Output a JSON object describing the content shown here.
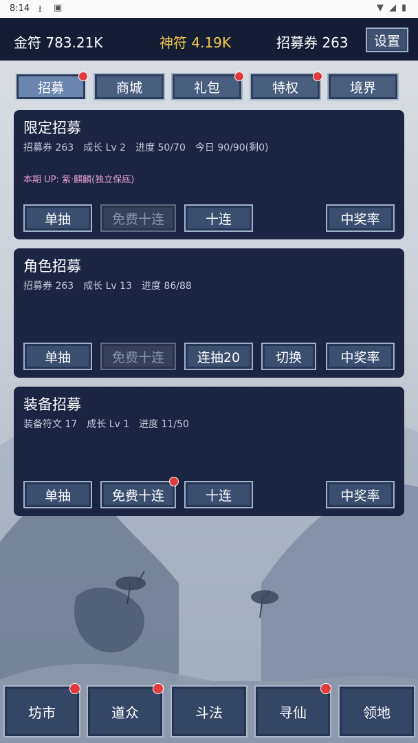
{
  "status_bar": {
    "time": "8:14"
  },
  "currencies": {
    "gold": "金符 783.21K",
    "divine": "神符 4.19K",
    "tickets": "招募券 263"
  },
  "settings_label": "设置",
  "tabs": [
    {
      "label": "招募",
      "active": true,
      "badge": true
    },
    {
      "label": "商城",
      "active": false,
      "badge": false
    },
    {
      "label": "礼包",
      "active": false,
      "badge": true
    },
    {
      "label": "特权",
      "active": false,
      "badge": true
    },
    {
      "label": "境界",
      "active": false,
      "badge": false
    }
  ],
  "cards": [
    {
      "title": "限定招募",
      "info": [
        "招募券 263",
        "成长 Lv 2",
        "进度 50/70",
        "今日 90/90(剩0)"
      ],
      "up": "本期 UP: 紫·麒麟(独立保底)",
      "buttons": [
        {
          "label": "单抽",
          "disabled": false
        },
        {
          "label": "免费十连",
          "disabled": true
        },
        {
          "label": "十连",
          "disabled": false
        },
        {
          "label": "中奖率",
          "disabled": false
        }
      ]
    },
    {
      "title": "角色招募",
      "info": [
        "招募券 263",
        "成长 Lv 13",
        "进度 86/88"
      ],
      "buttons": [
        {
          "label": "单抽",
          "disabled": false
        },
        {
          "label": "免费十连",
          "disabled": true
        },
        {
          "label": "连抽20",
          "disabled": false
        },
        {
          "label": "切换",
          "disabled": false
        },
        {
          "label": "中奖率",
          "disabled": false
        }
      ]
    },
    {
      "title": "装备招募",
      "info": [
        "装备符文 17",
        "成长 Lv 1",
        "进度 11/50"
      ],
      "buttons": [
        {
          "label": "单抽",
          "disabled": false
        },
        {
          "label": "免费十连",
          "disabled": false,
          "badge": true
        },
        {
          "label": "十连",
          "disabled": false
        },
        {
          "label": "中奖率",
          "disabled": false
        }
      ]
    }
  ],
  "bottom_nav": [
    {
      "label": "坊市",
      "badge": true
    },
    {
      "label": "道众",
      "badge": true
    },
    {
      "label": "斗法",
      "badge": false
    },
    {
      "label": "寻仙",
      "badge": true
    },
    {
      "label": "领地",
      "badge": false
    }
  ],
  "colors": {
    "topbar_bg": "#141d33",
    "divine_text": "#f2c94c",
    "gold_text": "#ffffff",
    "card_bg": "#1b2440",
    "card_title": "#ffffff",
    "up_text": "#e6a0d0",
    "badge": "#e23b3b"
  }
}
